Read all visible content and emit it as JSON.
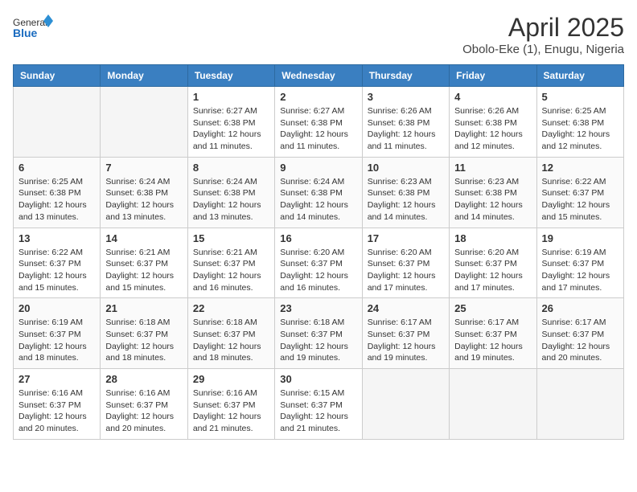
{
  "logo": {
    "general": "General",
    "blue": "Blue"
  },
  "header": {
    "month": "April 2025",
    "location": "Obolo-Eke (1), Enugu, Nigeria"
  },
  "columns": [
    "Sunday",
    "Monday",
    "Tuesday",
    "Wednesday",
    "Thursday",
    "Friday",
    "Saturday"
  ],
  "weeks": [
    [
      {
        "day": "",
        "sunrise": "",
        "sunset": "",
        "daylight": ""
      },
      {
        "day": "",
        "sunrise": "",
        "sunset": "",
        "daylight": ""
      },
      {
        "day": "1",
        "sunrise": "Sunrise: 6:27 AM",
        "sunset": "Sunset: 6:38 PM",
        "daylight": "Daylight: 12 hours and 11 minutes."
      },
      {
        "day": "2",
        "sunrise": "Sunrise: 6:27 AM",
        "sunset": "Sunset: 6:38 PM",
        "daylight": "Daylight: 12 hours and 11 minutes."
      },
      {
        "day": "3",
        "sunrise": "Sunrise: 6:26 AM",
        "sunset": "Sunset: 6:38 PM",
        "daylight": "Daylight: 12 hours and 11 minutes."
      },
      {
        "day": "4",
        "sunrise": "Sunrise: 6:26 AM",
        "sunset": "Sunset: 6:38 PM",
        "daylight": "Daylight: 12 hours and 12 minutes."
      },
      {
        "day": "5",
        "sunrise": "Sunrise: 6:25 AM",
        "sunset": "Sunset: 6:38 PM",
        "daylight": "Daylight: 12 hours and 12 minutes."
      }
    ],
    [
      {
        "day": "6",
        "sunrise": "Sunrise: 6:25 AM",
        "sunset": "Sunset: 6:38 PM",
        "daylight": "Daylight: 12 hours and 13 minutes."
      },
      {
        "day": "7",
        "sunrise": "Sunrise: 6:24 AM",
        "sunset": "Sunset: 6:38 PM",
        "daylight": "Daylight: 12 hours and 13 minutes."
      },
      {
        "day": "8",
        "sunrise": "Sunrise: 6:24 AM",
        "sunset": "Sunset: 6:38 PM",
        "daylight": "Daylight: 12 hours and 13 minutes."
      },
      {
        "day": "9",
        "sunrise": "Sunrise: 6:24 AM",
        "sunset": "Sunset: 6:38 PM",
        "daylight": "Daylight: 12 hours and 14 minutes."
      },
      {
        "day": "10",
        "sunrise": "Sunrise: 6:23 AM",
        "sunset": "Sunset: 6:38 PM",
        "daylight": "Daylight: 12 hours and 14 minutes."
      },
      {
        "day": "11",
        "sunrise": "Sunrise: 6:23 AM",
        "sunset": "Sunset: 6:38 PM",
        "daylight": "Daylight: 12 hours and 14 minutes."
      },
      {
        "day": "12",
        "sunrise": "Sunrise: 6:22 AM",
        "sunset": "Sunset: 6:37 PM",
        "daylight": "Daylight: 12 hours and 15 minutes."
      }
    ],
    [
      {
        "day": "13",
        "sunrise": "Sunrise: 6:22 AM",
        "sunset": "Sunset: 6:37 PM",
        "daylight": "Daylight: 12 hours and 15 minutes."
      },
      {
        "day": "14",
        "sunrise": "Sunrise: 6:21 AM",
        "sunset": "Sunset: 6:37 PM",
        "daylight": "Daylight: 12 hours and 15 minutes."
      },
      {
        "day": "15",
        "sunrise": "Sunrise: 6:21 AM",
        "sunset": "Sunset: 6:37 PM",
        "daylight": "Daylight: 12 hours and 16 minutes."
      },
      {
        "day": "16",
        "sunrise": "Sunrise: 6:20 AM",
        "sunset": "Sunset: 6:37 PM",
        "daylight": "Daylight: 12 hours and 16 minutes."
      },
      {
        "day": "17",
        "sunrise": "Sunrise: 6:20 AM",
        "sunset": "Sunset: 6:37 PM",
        "daylight": "Daylight: 12 hours and 17 minutes."
      },
      {
        "day": "18",
        "sunrise": "Sunrise: 6:20 AM",
        "sunset": "Sunset: 6:37 PM",
        "daylight": "Daylight: 12 hours and 17 minutes."
      },
      {
        "day": "19",
        "sunrise": "Sunrise: 6:19 AM",
        "sunset": "Sunset: 6:37 PM",
        "daylight": "Daylight: 12 hours and 17 minutes."
      }
    ],
    [
      {
        "day": "20",
        "sunrise": "Sunrise: 6:19 AM",
        "sunset": "Sunset: 6:37 PM",
        "daylight": "Daylight: 12 hours and 18 minutes."
      },
      {
        "day": "21",
        "sunrise": "Sunrise: 6:18 AM",
        "sunset": "Sunset: 6:37 PM",
        "daylight": "Daylight: 12 hours and 18 minutes."
      },
      {
        "day": "22",
        "sunrise": "Sunrise: 6:18 AM",
        "sunset": "Sunset: 6:37 PM",
        "daylight": "Daylight: 12 hours and 18 minutes."
      },
      {
        "day": "23",
        "sunrise": "Sunrise: 6:18 AM",
        "sunset": "Sunset: 6:37 PM",
        "daylight": "Daylight: 12 hours and 19 minutes."
      },
      {
        "day": "24",
        "sunrise": "Sunrise: 6:17 AM",
        "sunset": "Sunset: 6:37 PM",
        "daylight": "Daylight: 12 hours and 19 minutes."
      },
      {
        "day": "25",
        "sunrise": "Sunrise: 6:17 AM",
        "sunset": "Sunset: 6:37 PM",
        "daylight": "Daylight: 12 hours and 19 minutes."
      },
      {
        "day": "26",
        "sunrise": "Sunrise: 6:17 AM",
        "sunset": "Sunset: 6:37 PM",
        "daylight": "Daylight: 12 hours and 20 minutes."
      }
    ],
    [
      {
        "day": "27",
        "sunrise": "Sunrise: 6:16 AM",
        "sunset": "Sunset: 6:37 PM",
        "daylight": "Daylight: 12 hours and 20 minutes."
      },
      {
        "day": "28",
        "sunrise": "Sunrise: 6:16 AM",
        "sunset": "Sunset: 6:37 PM",
        "daylight": "Daylight: 12 hours and 20 minutes."
      },
      {
        "day": "29",
        "sunrise": "Sunrise: 6:16 AM",
        "sunset": "Sunset: 6:37 PM",
        "daylight": "Daylight: 12 hours and 21 minutes."
      },
      {
        "day": "30",
        "sunrise": "Sunrise: 6:15 AM",
        "sunset": "Sunset: 6:37 PM",
        "daylight": "Daylight: 12 hours and 21 minutes."
      },
      {
        "day": "",
        "sunrise": "",
        "sunset": "",
        "daylight": ""
      },
      {
        "day": "",
        "sunrise": "",
        "sunset": "",
        "daylight": ""
      },
      {
        "day": "",
        "sunrise": "",
        "sunset": "",
        "daylight": ""
      }
    ]
  ]
}
